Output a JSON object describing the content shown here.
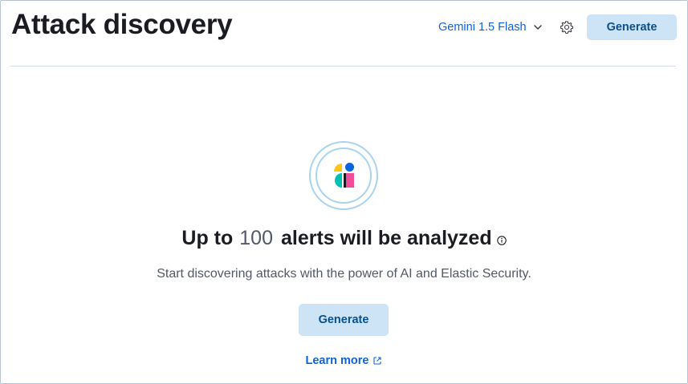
{
  "header": {
    "title": "Attack discovery",
    "connector_label": "Gemini 1.5 Flash",
    "generate_label": "Generate"
  },
  "empty_state": {
    "headline_prefix": "Up to",
    "alert_count": "100",
    "headline_suffix": "alerts will be analyzed",
    "subtitle": "Start discovering attacks with the power of AI and Elastic Security.",
    "generate_label": "Generate",
    "learn_more_label": "Learn more"
  },
  "icons": [
    "chevron-down-icon",
    "gear-icon",
    "assistant-logo-icon",
    "info-icon",
    "external-link-icon"
  ],
  "colors": {
    "primary_link": "#0b64dd",
    "button_bg": "#cce4f5",
    "button_text": "#0b4f8a",
    "logo_yellow": "#fec514",
    "logo_teal": "#00bfb3",
    "logo_blue": "#0b64dd",
    "logo_pink": "#f04e98"
  }
}
